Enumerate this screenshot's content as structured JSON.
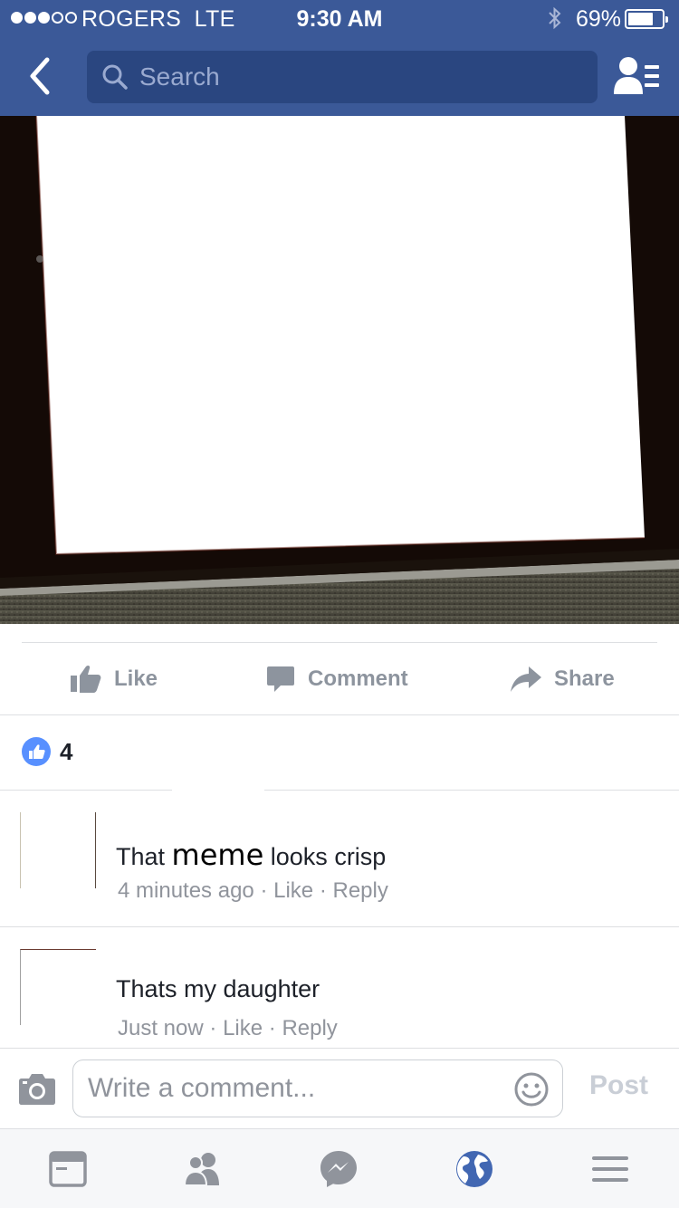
{
  "status_bar": {
    "carrier": "ROGERS",
    "network": "LTE",
    "time": "9:30 AM",
    "battery_percent": "69%",
    "battery_level": 0.69,
    "signal_bars_filled": 3,
    "signal_bars_total": 5
  },
  "nav": {
    "search_placeholder": "Search"
  },
  "actions": {
    "like": "Like",
    "comment": "Comment",
    "share": "Share"
  },
  "reactions": {
    "count": "4"
  },
  "comments": [
    {
      "text_before": "That",
      "text_emphasis": "meme",
      "text_after": "looks crisp",
      "time": "4 minutes ago",
      "like": "Like",
      "reply": "Reply",
      "separator": "·"
    },
    {
      "text": "Thats my daughter",
      "time": "Just now",
      "like": "Like",
      "reply": "Reply",
      "separator": "·"
    }
  ],
  "composer": {
    "placeholder": "Write a comment...",
    "post_label": "Post"
  },
  "colors": {
    "brand": "#3b5998",
    "search_bg": "#2a4680",
    "muted_text": "#90949c",
    "like_blue": "#5890ff",
    "active_tab": "#4267b2"
  },
  "icons": [
    "back-chevron-icon",
    "search-icon",
    "friends-list-icon",
    "like-thumb-icon",
    "comment-bubble-icon",
    "share-arrow-icon",
    "camera-icon",
    "emoji-icon",
    "news-feed-icon",
    "friends-icon",
    "messenger-icon",
    "globe-icon",
    "menu-icon"
  ]
}
